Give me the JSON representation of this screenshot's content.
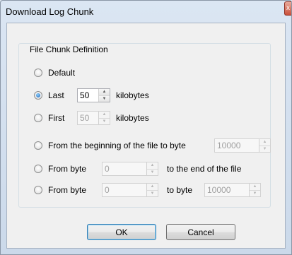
{
  "window": {
    "title": "Download Log Chunk",
    "close_glyph": "x"
  },
  "group": {
    "legend": "File Chunk Definition"
  },
  "options": [
    {
      "label": "Default",
      "selected": false
    },
    {
      "label": "Last",
      "selected": true,
      "value": "50",
      "suffix": "kilobytes"
    },
    {
      "label": "First",
      "selected": false,
      "value": "50",
      "suffix": "kilobytes"
    },
    {
      "label": "From the beginning of the file to byte",
      "selected": false,
      "value": "10000"
    },
    {
      "label": "From byte",
      "selected": false,
      "value": "0",
      "suffix": "to the end of the file"
    },
    {
      "label": "From byte",
      "selected": false,
      "value": "0",
      "middle": "to byte",
      "value2": "10000"
    }
  ],
  "buttons": {
    "ok": "OK",
    "cancel": "Cancel"
  },
  "icons": {
    "spinner_up": "▲",
    "spinner_down": "▼"
  }
}
